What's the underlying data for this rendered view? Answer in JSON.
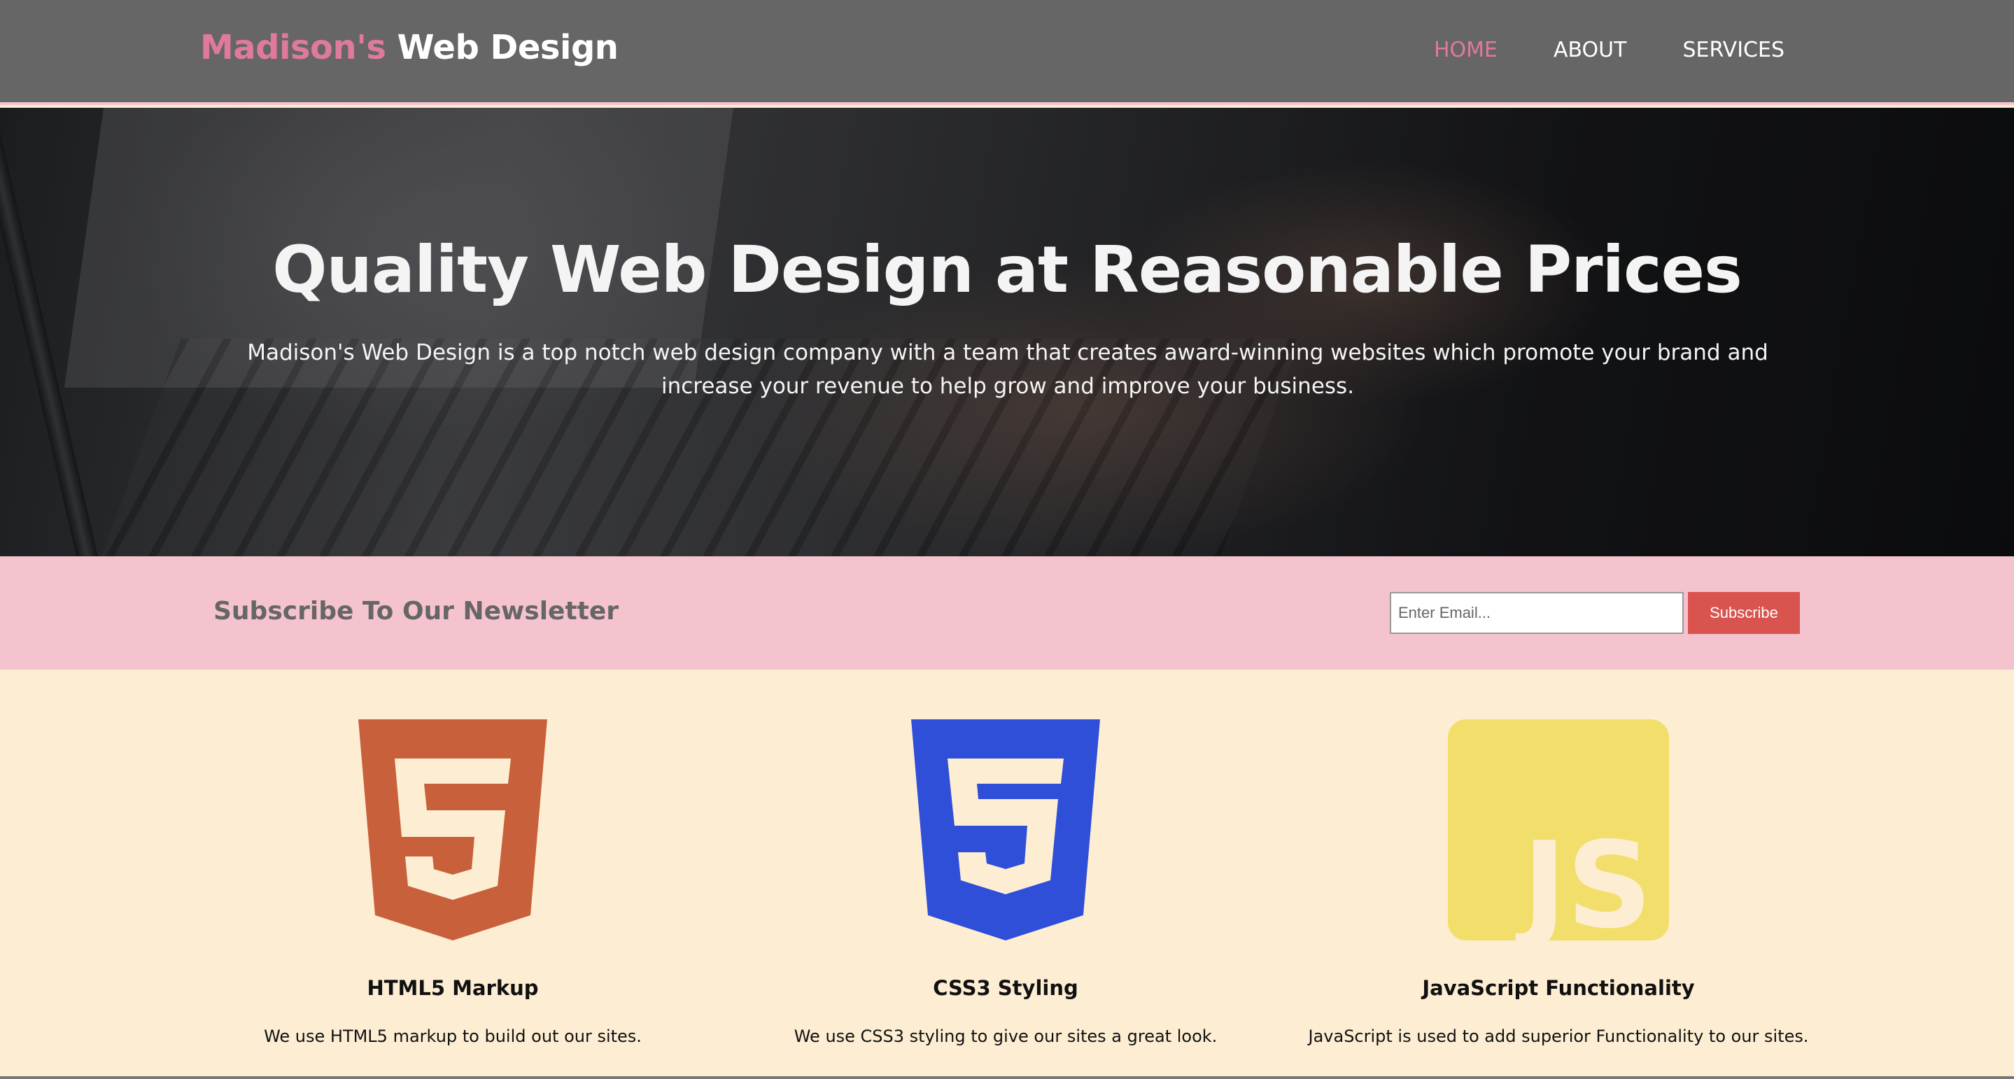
{
  "header": {
    "logo_brand": "Madison's",
    "logo_rest": " Web Design",
    "nav": [
      {
        "label": "HOME",
        "active": true
      },
      {
        "label": "ABOUT",
        "active": false
      },
      {
        "label": "SERVICES",
        "active": false
      }
    ]
  },
  "hero": {
    "title": "Quality Web Design at Reasonable Prices",
    "text": "Madison's Web Design is a top notch web design company with a team that creates award-winning websites which promote your brand and increase your revenue to help grow and improve your business."
  },
  "newsletter": {
    "title": "Subscribe To Our Newsletter",
    "email_placeholder": "Enter Email...",
    "button_label": "Subscribe"
  },
  "features": [
    {
      "icon": "html5-icon",
      "title": "HTML5 Markup",
      "text": "We use HTML5 markup to build out our sites."
    },
    {
      "icon": "css3-icon",
      "title": "CSS3 Styling",
      "text": "We use CSS3 styling to give our sites a great look."
    },
    {
      "icon": "javascript-icon",
      "title": "JavaScript Functionality",
      "text": "JavaScript is used to add superior Functionality to our sites."
    }
  ],
  "colors": {
    "header_bg": "#666666",
    "accent_pink": "#e07a9c",
    "newsletter_bg": "#f5c3ce",
    "features_bg": "#fdeed3",
    "subscribe_button": "#d9534f",
    "html5": "#c8603b",
    "css3": "#2f4fd9",
    "javascript": "#f2df6b"
  }
}
